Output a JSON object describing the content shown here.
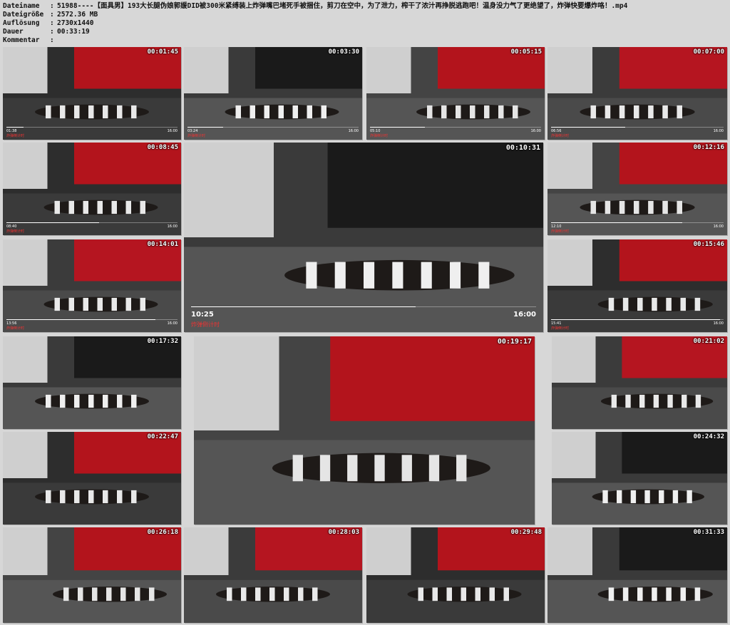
{
  "header": {
    "rows": [
      {
        "key": "Dateiname",
        "value": "51988----【面具男】193大长腿伪娘郭媛DID被300米紧缚装上炸弹嘴巴堵死手被捆住，剪刀在空中，为了泄力，榨干了浓汁再挣脱逃跑吧！温身没力气了更绝望了，炸弹快要爆炸咯！.mp4"
      },
      {
        "key": "Dateigröße",
        "value": "2572.36 MB"
      },
      {
        "key": "Auflösung",
        "value": "2730x1440"
      },
      {
        "key": "Dauer",
        "value": "00:33:19"
      },
      {
        "key": "Kommentar",
        "value": ""
      }
    ]
  },
  "bar_caption": "炸弹倒计时",
  "bar_total": "16:00",
  "thumbnails": [
    {
      "timestamp": "00:01:45",
      "bar_current": "01:38",
      "progress": 0.1
    },
    {
      "timestamp": "00:03:30",
      "bar_current": "03:24",
      "progress": 0.21
    },
    {
      "timestamp": "00:05:15",
      "bar_current": "05:10",
      "progress": 0.32
    },
    {
      "timestamp": "00:07:00",
      "bar_current": "06:56",
      "progress": 0.43
    },
    {
      "timestamp": "00:08:45",
      "bar_current": "08:40",
      "progress": 0.54
    },
    {
      "timestamp": "00:10:31",
      "bar_current": "10:25",
      "progress": 0.65
    },
    {
      "timestamp": "00:12:16",
      "bar_current": "12:10",
      "progress": 0.76
    },
    {
      "timestamp": "00:14:01",
      "bar_current": "13:56",
      "progress": 0.87
    },
    {
      "timestamp": "00:15:46",
      "bar_current": "15:41",
      "progress": 0.98
    },
    {
      "timestamp": "00:17:32",
      "bar_current": "",
      "progress": 0
    },
    {
      "timestamp": "00:19:17",
      "bar_current": "",
      "progress": 0
    },
    {
      "timestamp": "00:21:02",
      "bar_current": "",
      "progress": 0
    },
    {
      "timestamp": "00:22:47",
      "bar_current": "",
      "progress": 0
    },
    {
      "timestamp": "00:24:32",
      "bar_current": "",
      "progress": 0
    },
    {
      "timestamp": "00:26:18",
      "bar_current": "",
      "progress": 0
    },
    {
      "timestamp": "00:28:03",
      "bar_current": "",
      "progress": 0
    },
    {
      "timestamp": "00:29:48",
      "bar_current": "",
      "progress": 0
    },
    {
      "timestamp": "00:31:33",
      "bar_current": "",
      "progress": 0
    }
  ]
}
